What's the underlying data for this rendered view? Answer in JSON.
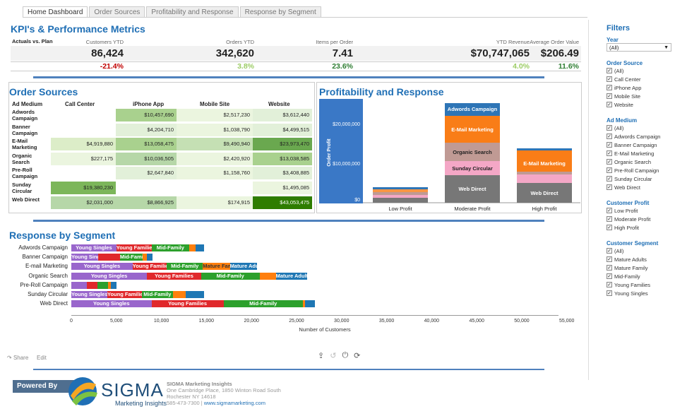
{
  "tabs": [
    "Home Dashboard",
    "Order Sources",
    "Profitability and Response",
    "Response by Segment"
  ],
  "kpi": {
    "title": "KPI's & Performance Metrics",
    "row_label": "Actuals vs. Plan",
    "metrics": [
      {
        "label": "Customers YTD",
        "value": "86,424",
        "pct": "-21.4%",
        "color": "#c00000"
      },
      {
        "label": "Orders YTD",
        "value": "342,620",
        "pct": "3.8%",
        "color": "#9ccc65"
      },
      {
        "label": "Items per Order",
        "value": "7.41",
        "pct": "23.6%",
        "color": "#2e7d32"
      },
      {
        "label": "YTD Revenue",
        "value": "$70,747,065",
        "pct": "4.0%",
        "color": "#9ccc65"
      },
      {
        "label": "Average Order Value",
        "value": "$206.49",
        "pct": "11.6%",
        "color": "#2e7d32"
      }
    ]
  },
  "order_sources": {
    "title": "Order Sources",
    "headers": [
      "Ad Medium",
      "Call Center",
      "iPhone App",
      "Mobile Site",
      "Website"
    ],
    "rows": [
      {
        "name": "Adwords Campaign",
        "cells": [
          "",
          "$10,457,690",
          "$2,517,230",
          "$3,612,440"
        ],
        "colors": [
          "",
          "#a9d18e",
          "#ebf5df",
          "#e2f0d9"
        ]
      },
      {
        "name": "Banner Campaign",
        "cells": [
          "",
          "$4,204,710",
          "$1,038,790",
          "$4,499,515"
        ],
        "colors": [
          "",
          "#e2f0d9",
          "#ebf5df",
          "#e2f0d9"
        ]
      },
      {
        "name": "E-Mail Marketing",
        "cells": [
          "$4,919,880",
          "$13,058,475",
          "$9,490,940",
          "$23,973,470"
        ],
        "colors": [
          "#dcedc8",
          "#a9d18e",
          "#c5e0b4",
          "#6aa84f"
        ]
      },
      {
        "name": "Organic Search",
        "cells": [
          "$227,175",
          "$10,036,505",
          "$2,420,920",
          "$13,038,585"
        ],
        "colors": [
          "#ebf5df",
          "#b6d7a8",
          "#ebf5df",
          "#a9d18e"
        ]
      },
      {
        "name": "Pre-Roll Campaign",
        "cells": [
          "",
          "$2,647,840",
          "$1,158,760",
          "$3,408,885"
        ],
        "colors": [
          "",
          "#e2f0d9",
          "#ebf5df",
          "#e2f0d9"
        ]
      },
      {
        "name": "Sunday Circular",
        "cells": [
          "$19,380,230",
          "",
          "",
          "$1,495,085"
        ],
        "colors": [
          "#7cb65a",
          "",
          "",
          "#ebf5df"
        ]
      },
      {
        "name": "Web Direct",
        "cells": [
          "$2,031,000",
          "$8,866,925",
          "$174,915",
          "$43,053,475"
        ],
        "colors": [
          "#b6d7a8",
          "#b6d7a8",
          "#ebf5df",
          "#2e7d00"
        ]
      }
    ]
  },
  "profitability": {
    "title": "Profitability and Response",
    "ylabel": "Order Profit",
    "yticks": [
      "$20,000,000",
      "$10,000,000",
      "$0"
    ],
    "categories": [
      "Low Profit",
      "Moderate Profit",
      "High Profit"
    ],
    "segments": [
      "Adwords Campaign",
      "E-Mail Marketing",
      "Organic Search",
      "Sunday Circular",
      "Web Direct",
      "E-Mail Marketing",
      "Web Direct"
    ]
  },
  "segment": {
    "title": "Response by Segment",
    "xlabel": "Number of Customers",
    "ticks": [
      "0",
      "5,000",
      "10,000",
      "15,000",
      "20,000",
      "25,000",
      "30,000",
      "35,000",
      "40,000",
      "45,000",
      "50,000",
      "55,000"
    ],
    "rows": [
      "Adwords Campaign",
      "Banner Campaign",
      "E-mail Marketing",
      "Organic Search",
      "Pre-Roll Campaign",
      "Sunday Circular",
      "Web Direct"
    ],
    "labels": [
      "Young Singles",
      "Young Families",
      "Mid-Family",
      "Mature Family",
      "Mature Adults"
    ]
  },
  "filters": {
    "title": "Filters",
    "year_label": "Year",
    "year_value": "(All)",
    "order_source_label": "Order Source",
    "order_source": [
      "(All)",
      "Call Center",
      "iPhone App",
      "Mobile Site",
      "Website"
    ],
    "ad_medium_label": "Ad Medium",
    "ad_medium": [
      "(All)",
      "Adwords Campaign",
      "Banner Campaign",
      "E-Mail Marketing",
      "Organic Search",
      "Pre-Roll Campaign",
      "Sunday Circular",
      "Web Direct"
    ],
    "profit_label": "Customer Profit",
    "profit": [
      "Low Profit",
      "Moderate Profit",
      "High Profit"
    ],
    "seg_label": "Customer Segment",
    "seg": [
      "(All)",
      "Mature Adults",
      "Mature Family",
      "Mid-Family",
      "Young Families",
      "Young Singles"
    ]
  },
  "footer": {
    "share": "Share",
    "edit": "Edit",
    "powered": "Powered By",
    "logo": "SIGMA",
    "logo_sub": "Marketing Insights",
    "company": "SIGMA Marketing Insights",
    "addr1": "One Cambridge Place, 1850 Winton Road South",
    "addr2": "Rochester NY 14618",
    "phone": "585-473-7300 | ",
    "url": "www.sigmamarketing.com"
  }
}
